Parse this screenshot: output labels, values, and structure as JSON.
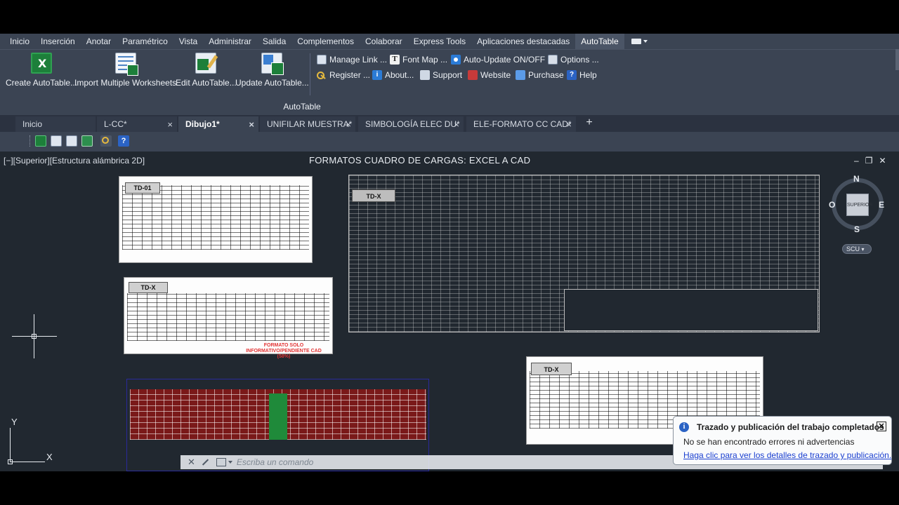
{
  "ribbon": {
    "tabs": [
      "Inicio",
      "Inserción",
      "Anotar",
      "Paramétrico",
      "Vista",
      "Administrar",
      "Salida",
      "Complementos",
      "Colaborar",
      "Express Tools",
      "Aplicaciones destacadas",
      "AutoTable"
    ],
    "active_tab": "AutoTable",
    "big_buttons": [
      {
        "label": "Create AutoTable...",
        "icon": "excel-icon"
      },
      {
        "label": "Import Multiple Worksheets",
        "icon": "worksheets-icon"
      },
      {
        "label": "Edit AutoTable...",
        "icon": "edit-table-icon"
      },
      {
        "label": "Update AutoTable...",
        "icon": "update-table-icon"
      }
    ],
    "small_buttons": [
      {
        "label": "Manage Link ...",
        "icon": "link-icon"
      },
      {
        "label": "Font Map ...",
        "icon": "font-icon"
      },
      {
        "label": "Auto-Update ON/OFF",
        "icon": "auto-update-icon"
      },
      {
        "label": "Options ...",
        "icon": "options-icon"
      },
      {
        "label": "Register ...",
        "icon": "key-icon"
      },
      {
        "label": "About...",
        "icon": "info-icon"
      },
      {
        "label": "Support",
        "icon": "support-icon"
      },
      {
        "label": "Website",
        "icon": "website-icon"
      },
      {
        "label": "Purchase",
        "icon": "cart-icon"
      },
      {
        "label": "Help",
        "icon": "help-icon"
      }
    ],
    "panel_title": "AutoTable"
  },
  "file_tabs": [
    {
      "label": "Inicio"
    },
    {
      "label": "L-CC*"
    },
    {
      "label": "Dibujo1*"
    },
    {
      "label": "UNIFILAR MUESTRA*"
    },
    {
      "label": "SIMBOLOGÍA ELEC DU*"
    },
    {
      "label": "ELE-FORMATO CC CAD*"
    }
  ],
  "active_file_tab": "Dibujo1*",
  "tab_close_glyph": "×",
  "tab_add_glyph": "+",
  "viewport": {
    "label": "[−][Superior][Estructura alámbrica 2D]",
    "title": "FORMATOS CUADRO DE CARGAS: EXCEL A CAD",
    "window_controls": [
      "‒",
      "❐",
      "✕"
    ]
  },
  "sheets": {
    "td01_tag": "TD-01",
    "tdx_tag": "TD-X",
    "tdx_dark_tag": "TD-X",
    "tdx_small_tag": "TD-X",
    "red_note": "FORMATO SOLO INFORMATIVO/PENDIENTE CAD (58%)"
  },
  "viewcube": {
    "n": "N",
    "s": "S",
    "e": "E",
    "o": "O",
    "face": "SUPERIOR",
    "scu_label": "SCU"
  },
  "ucs": {
    "x_label": "X",
    "y_label": "Y"
  },
  "command_line": {
    "placeholder": "Escriba un comando"
  },
  "notification": {
    "title": "Trazado y publicación del trabajo completados",
    "body": "No se han encontrado errores ni advertencias",
    "link": "Haga clic para ver los detalles de trazado y publicación."
  },
  "colors": {
    "ribbon_bg": "#3b4453",
    "drawing_bg": "#212830",
    "accent_link": "#1a3fd0",
    "red_table": "#7a1919"
  }
}
